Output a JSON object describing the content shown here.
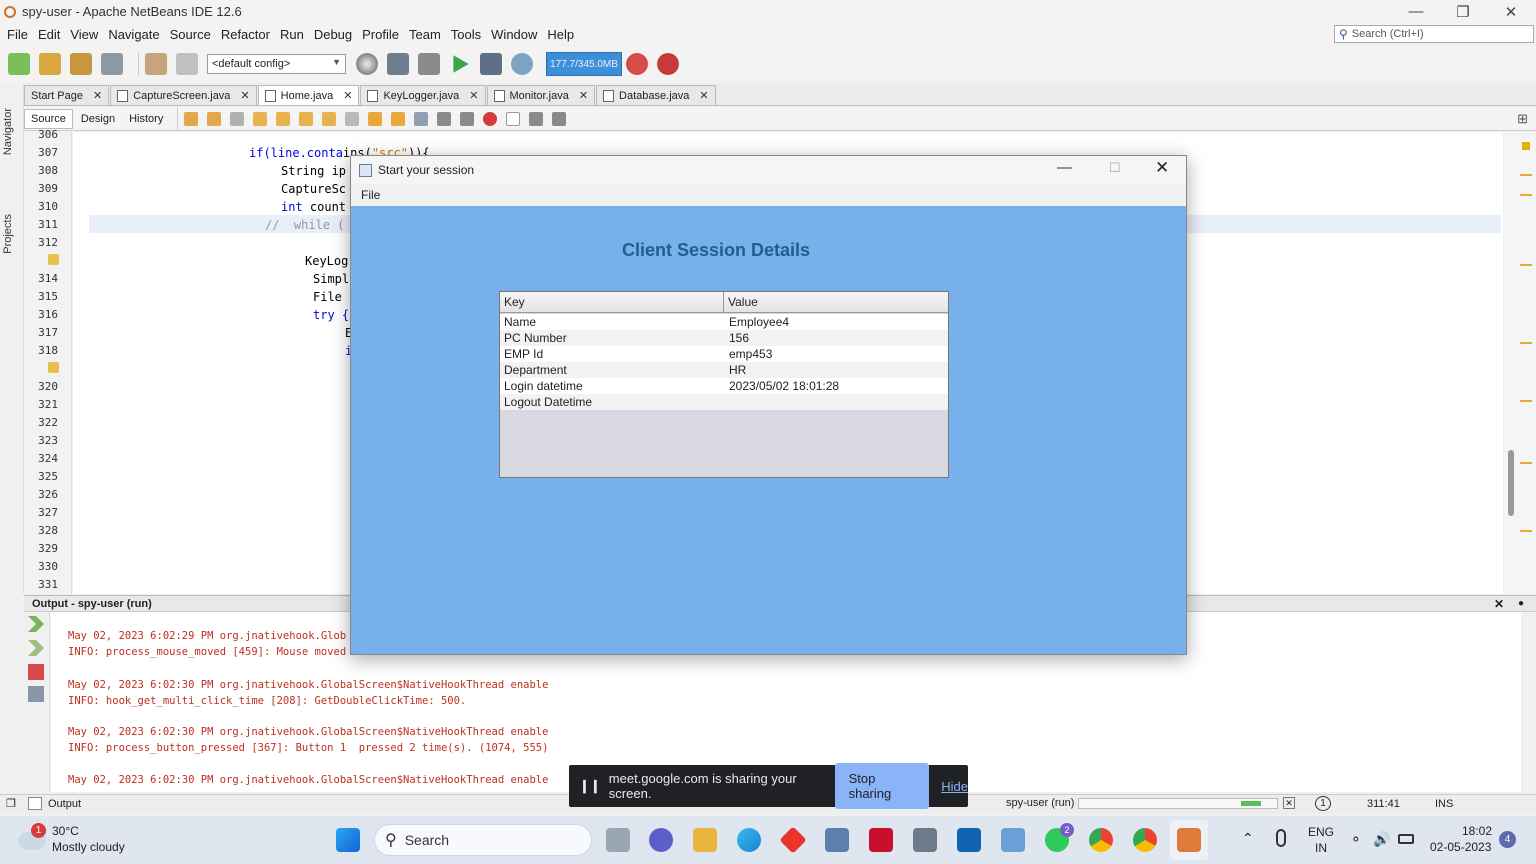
{
  "window": {
    "title": "spy-user - Apache NetBeans IDE 12.6"
  },
  "menubar": [
    "File",
    "Edit",
    "View",
    "Navigate",
    "Source",
    "Refactor",
    "Run",
    "Debug",
    "Profile",
    "Team",
    "Tools",
    "Window",
    "Help"
  ],
  "search": {
    "placeholder": "Search (Ctrl+I)"
  },
  "toolbar": {
    "config": "<default config>",
    "memory": "177.7/345.0MB"
  },
  "sidebar": {
    "navigator": "Navigator",
    "projects": "Projects"
  },
  "tabs": [
    {
      "label": "Start Page"
    },
    {
      "label": "CaptureScreen.java"
    },
    {
      "label": "Home.java"
    },
    {
      "label": "KeyLogger.java"
    },
    {
      "label": "Monitor.java"
    },
    {
      "label": "Database.java"
    }
  ],
  "editor_modes": {
    "source": "Source",
    "design": "Design",
    "history": "History"
  },
  "code": {
    "line_numbers": [
      "306",
      "307",
      "308",
      "309",
      "310",
      "311",
      "312",
      "",
      "314",
      "315",
      "316",
      "317",
      "318",
      "",
      "320",
      "321",
      "322",
      "323",
      "324",
      "325",
      "326",
      "327",
      "328",
      "329",
      "330",
      "331"
    ],
    "l307a": "if(line.conta",
    "l307b": "ins(",
    "l307c": "\"src\"",
    "l307d": ")){",
    "l308": "String ip",
    "l309": "CaptureSc",
    "l310a": "int",
    "l310b": " count",
    "l311": "//  while (",
    "l313": "KeyLog",
    "l314": "Simpl",
    "l315": "File",
    "l316": "try {",
    "l317": "E",
    "l318": "i"
  },
  "output": {
    "title": "Output - spy-user (run)",
    "lines": [
      "May 02, 2023 6:02:29 PM org.jnativehook.Glob",
      "INFO: process_mouse_moved [459]: Mouse moved",
      "May 02, 2023 6:02:30 PM org.jnativehook.GlobalScreen$NativeHookThread enable",
      "INFO: hook_get_multi_click_time [208]: GetDoubleClickTime: 500.",
      "May 02, 2023 6:02:30 PM org.jnativehook.GlobalScreen$NativeHookThread enable",
      "INFO: process_button_pressed [367]: Button 1  pressed 2 time(s). (1074, 555)",
      "May 02, 2023 6:02:30 PM org.jnativehook.GlobalScreen$NativeHookThread enable"
    ]
  },
  "statusbar": {
    "output_tab": "Output",
    "run": "spy-user (run)",
    "notifications": "1",
    "position": "311:41",
    "mode": "INS"
  },
  "dialog": {
    "title": "Start your session",
    "menu_file": "File",
    "heading": "Client Session Details",
    "columns": [
      "Key",
      "Value"
    ],
    "rows": [
      {
        "key": "Name",
        "value": "Employee4"
      },
      {
        "key": "PC Number",
        "value": "156"
      },
      {
        "key": "EMP Id",
        "value": "emp453"
      },
      {
        "key": "Department",
        "value": "HR"
      },
      {
        "key": "Login datetime",
        "value": "2023/05/02 18:01:28"
      },
      {
        "key": "Logout Datetime",
        "value": ""
      }
    ]
  },
  "share_banner": {
    "text": "meet.google.com is sharing your screen.",
    "stop": "Stop sharing",
    "hide": "Hide"
  },
  "taskbar": {
    "weather_temp": "30°C",
    "weather_desc": "Mostly cloudy",
    "weather_badge": "1",
    "search": "Search",
    "whatsapp_badge": "2",
    "lang_1": "ENG",
    "lang_2": "IN",
    "time": "18:02",
    "date": "02-05-2023",
    "notif_count": "4"
  },
  "colors": {
    "dialog_bg": "#78b0ec",
    "heading": "#1f5f8a",
    "output_text": "#c12f1f",
    "keyword": "#0000e6",
    "string": "#ce7b00"
  }
}
